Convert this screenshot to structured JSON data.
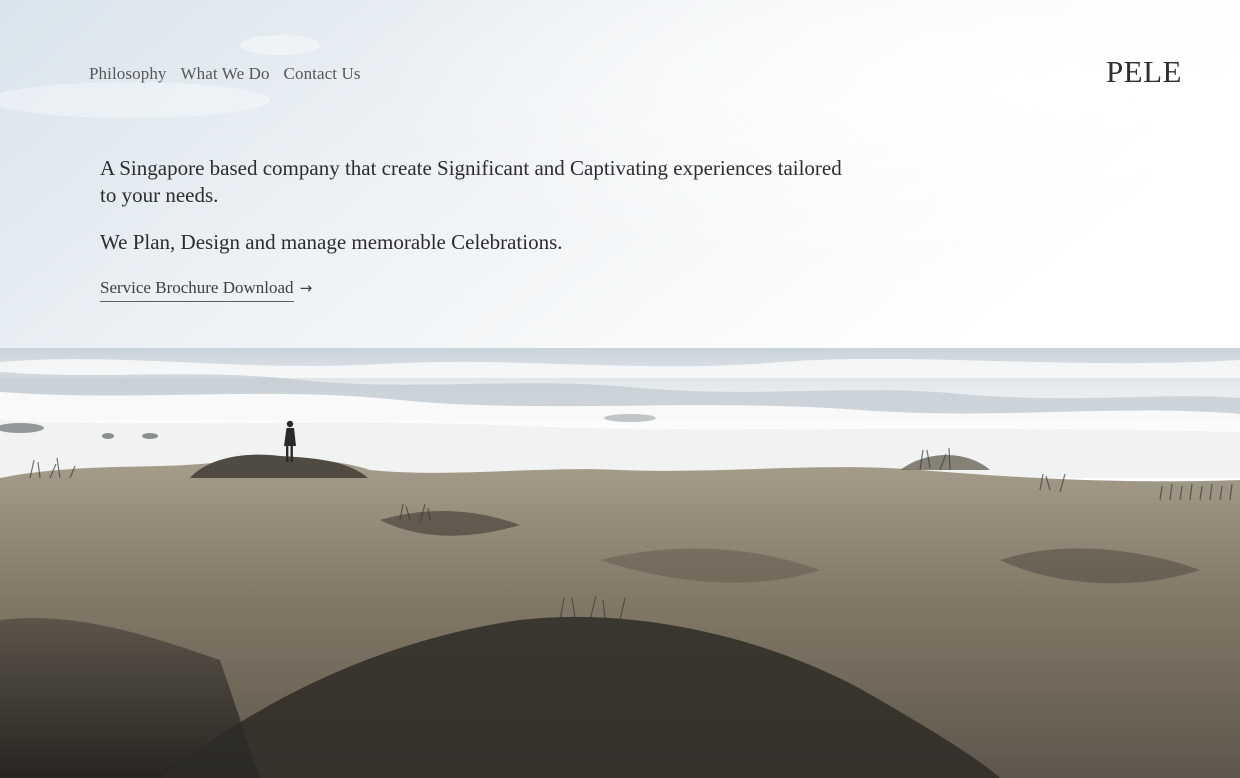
{
  "nav": {
    "items": [
      {
        "label": "Philosophy"
      },
      {
        "label": "What We Do"
      },
      {
        "label": "Contact Us"
      }
    ]
  },
  "brand": {
    "logo_text": "PELE"
  },
  "hero": {
    "tagline": "A Singapore based company that create Significant and Captivating experiences tailored to your needs.",
    "services": "We Plan, Design and manage memorable Celebrations.",
    "download_label": "Service Brochure Download",
    "download_arrow": "→"
  },
  "colors": {
    "text_dark": "#2b2d30",
    "nav_text": "#55585c",
    "sky_top": "#e3ebf1",
    "sea_foam": "#eef1f2",
    "dune": "#6d665a"
  }
}
